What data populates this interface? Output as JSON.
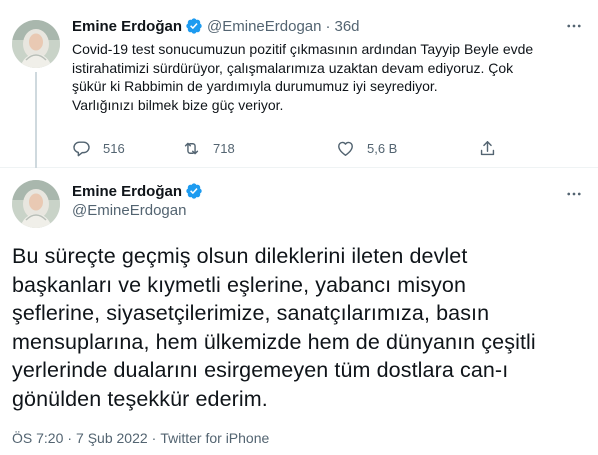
{
  "colors": {
    "text": "#0f1419",
    "secondary": "#536471",
    "verified": "#1d9bf0",
    "divider": "#eff3f4"
  },
  "tweet1": {
    "author_name": "Emine Erdoğan",
    "handle": "@EmineErdogan",
    "separator": "·",
    "time": "36d",
    "text_lines": [
      "Covid-19 test sonucumuzun pozitif çıkmasının ardından Tayyip Beyle evde",
      "istirahatimizi sürdürüyor, çalışmalarımıza uzaktan devam ediyoruz. Çok",
      "şükür ki Rabbimin de yardımıyla durumumuz iyi seyrediyor.",
      "Varlığınızı bilmek bize güç veriyor."
    ],
    "reply_count": "516",
    "retweet_count": "718",
    "like_count": "5,6 B"
  },
  "tweet2": {
    "author_name": "Emine Erdoğan",
    "handle": "@EmineErdogan",
    "text_lines": [
      "Bu süreçte geçmiş olsun dileklerini ileten devlet",
      "başkanları ve kıymetli eşlerine, yabancı misyon",
      "şeflerine, siyasetçilerimize, sanatçılarımıza, basın",
      "mensuplarına, hem ülkemizde hem de dünyanın çeşitli",
      "yerlerinde dualarını esirgemeyen tüm dostlara can-ı",
      "gönülden teşekkür ederim."
    ],
    "time": "ÖS 7:20",
    "separator": "·",
    "date": "7 Şub 2022",
    "source": "Twitter for iPhone"
  },
  "icons": {
    "verified": "verified-badge-icon",
    "more": "more-horizontal-icon",
    "reply": "reply-bubble-icon",
    "retweet": "retweet-icon",
    "like": "heart-icon",
    "share": "share-upload-icon"
  }
}
